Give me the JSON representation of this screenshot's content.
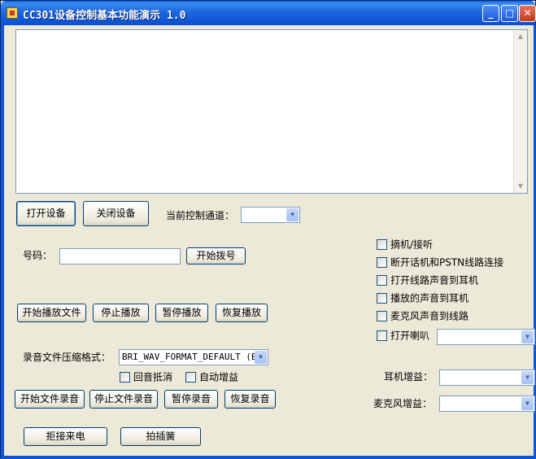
{
  "window": {
    "title": "CC301设备控制基本功能演示 1.0",
    "minimize": "_",
    "maximize": "□",
    "close": "✕"
  },
  "log": {
    "text": ""
  },
  "device": {
    "open_button": "打开设备",
    "close_button": "关闭设备",
    "channel_label": "当前控制通道：",
    "channel_value": ""
  },
  "dial": {
    "number_label": "号码：",
    "number_value": "",
    "dial_button": "开始拨号"
  },
  "playback": {
    "start": "开始播放文件",
    "stop": "停止播放",
    "pause": "暂停播放",
    "resume": "恢复播放"
  },
  "recording": {
    "format_label": "录音文件压缩格式：",
    "format_value": "BRI_WAV_FORMAT_DEFAULT (BRI",
    "echo_cancel": "回音抵消",
    "auto_gain": "自动增益",
    "start": "开始文件录音",
    "stop": "停止文件录音",
    "pause": "暂停录音",
    "resume": "恢复录音"
  },
  "call": {
    "reject": "拒接来电",
    "flash": "拍插簧"
  },
  "options": [
    {
      "label": "摘机/接听",
      "checked": false
    },
    {
      "label": "断开话机和PSTN线路连接",
      "checked": false
    },
    {
      "label": "打开线路声音到耳机",
      "checked": false
    },
    {
      "label": "播放的声音到耳机",
      "checked": false
    },
    {
      "label": "麦克风声音到线路",
      "checked": false
    },
    {
      "label": "打开喇叭",
      "checked": false
    }
  ],
  "speaker_value": "",
  "gain": {
    "earphone_label": "耳机增益：",
    "earphone_value": "",
    "mic_label": "麦克风增益：",
    "mic_value": ""
  },
  "icons": {
    "dropdown": "▼",
    "scroll_up": "▲",
    "scroll_down": "▼"
  }
}
